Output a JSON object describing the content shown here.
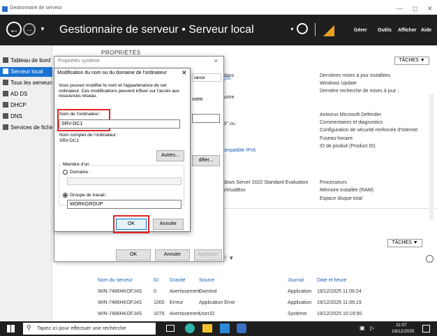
{
  "window": {
    "title": "Gestionnaire de serveur"
  },
  "header": {
    "breadcrumb": "Gestionnaire de serveur • Serveur local",
    "menu": [
      "Gérer",
      "Outils",
      "Afficher",
      "Aide"
    ]
  },
  "sidebar": {
    "items": [
      {
        "label": "Tableau de bord"
      },
      {
        "label": "Serveur local"
      },
      {
        "label": "Tous les serveurs"
      },
      {
        "label": "AD DS"
      },
      {
        "label": "DHCP"
      },
      {
        "label": "DNS"
      },
      {
        "label": "Services de fichiers et de stockage"
      }
    ]
  },
  "properties": {
    "heading": "PROPRIÉTÉS",
    "taches": "TÂCHES",
    "mid_frag": [
      "dans",
      "{JS",
      "votre",
      "S\" ou",
      "ompatible IPv6"
    ],
    "right_col": [
      "Dernières mises à jour installées",
      "Windows Update",
      "Dernière recherche de mises à jour :",
      "Antivirus Microsoft Defender",
      "Commentaires et diagnostics",
      "Configuration de sécurité renforcée d'Internet",
      "Fuseau horaire",
      "ID de produit (Product ID)",
      "Processeurs",
      "Mémoire installée (RAM)",
      "Espace disque total"
    ],
    "os": "dows Server 2022 Standard Evaluation",
    "vm": "VirtualBox"
  },
  "dlg_sys": {
    "title": "Propriétés système",
    "ok": "OK",
    "cancel": "Annuler",
    "apply": "Appliquer",
    "modify": "difier..."
  },
  "dlg_name": {
    "title": "Modification du nom ou du domaine de l'ordinateur",
    "desc": "Vous pouvez modifier le nom et l'appartenance de cet ordinateur. Ces modifications peuvent influer sur l'accès aux ressources réseau.",
    "name_label": "Nom de l'ordinateur :",
    "name_value": "SRV-DC1",
    "full_label": "Nom complet de l'ordinateur :",
    "full_value": "SRV-DC1",
    "more": "Autres...",
    "member_of": "Membre d'un",
    "domain": "Domaine :",
    "workgroup": "Groupe de travail :",
    "workgroup_value": "WORKGROUP",
    "ok": "OK",
    "cancel": "Annuler"
  },
  "events": {
    "taches": "TÂCHES",
    "filter": "Filtre",
    "columns": [
      "Nom du serveur",
      "ID",
      "Gravité",
      "Source",
      "Journal",
      "Date et heure"
    ],
    "rows": [
      [
        "WIN-7486HKOFJ4S",
        "0",
        "Avertissement",
        "Dwmind",
        "Application",
        "19/12/2025 11:06:24"
      ],
      [
        "WIN-7486HKOFJ4S",
        "1000",
        "Erreur",
        "Application Error",
        "Application",
        "19/12/2025 11:06:19"
      ],
      [
        "WIN-7486HKOFJ4S",
        "1076",
        "Avertissement",
        "User32",
        "Système",
        "19/12/2025 10:19:50"
      ]
    ]
  },
  "taskbar": {
    "search": "Tapez ici pour effectuer une recherche",
    "time": "11:07",
    "date": "19/12/2025"
  }
}
